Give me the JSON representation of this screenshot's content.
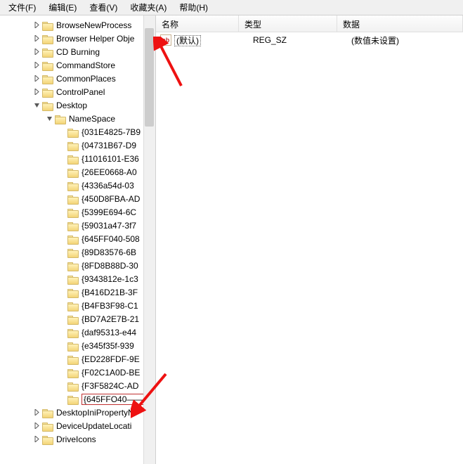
{
  "menu": {
    "file": "文件(F)",
    "edit": "编辑(E)",
    "view": "查看(V)",
    "favorites": "收藏夹(A)",
    "help": "帮助(H)"
  },
  "tree": {
    "items": [
      {
        "indent": 46,
        "expander": "right",
        "label": "BrowseNewProcess"
      },
      {
        "indent": 46,
        "expander": "right",
        "label": "Browser Helper Obje"
      },
      {
        "indent": 46,
        "expander": "right",
        "label": "CD Burning"
      },
      {
        "indent": 46,
        "expander": "right",
        "label": "CommandStore"
      },
      {
        "indent": 46,
        "expander": "right",
        "label": "CommonPlaces"
      },
      {
        "indent": 46,
        "expander": "right",
        "label": "ControlPanel"
      },
      {
        "indent": 46,
        "expander": "down",
        "label": "Desktop"
      },
      {
        "indent": 64,
        "expander": "down",
        "label": "NameSpace"
      },
      {
        "indent": 82,
        "expander": "none",
        "label": "{031E4825-7B9"
      },
      {
        "indent": 82,
        "expander": "none",
        "label": "{04731B67-D9"
      },
      {
        "indent": 82,
        "expander": "none",
        "label": "{11016101-E36"
      },
      {
        "indent": 82,
        "expander": "none",
        "label": "{26EE0668-A0"
      },
      {
        "indent": 82,
        "expander": "none",
        "label": "{4336a54d-03"
      },
      {
        "indent": 82,
        "expander": "none",
        "label": "{450D8FBA-AD"
      },
      {
        "indent": 82,
        "expander": "none",
        "label": "{5399E694-6C"
      },
      {
        "indent": 82,
        "expander": "none",
        "label": "{59031a47-3f7"
      },
      {
        "indent": 82,
        "expander": "none",
        "label": "{645FF040-508"
      },
      {
        "indent": 82,
        "expander": "none",
        "label": "{89D83576-6B"
      },
      {
        "indent": 82,
        "expander": "none",
        "label": "{8FD8B88D-30"
      },
      {
        "indent": 82,
        "expander": "none",
        "label": "{9343812e-1c3"
      },
      {
        "indent": 82,
        "expander": "none",
        "label": "{B416D21B-3F"
      },
      {
        "indent": 82,
        "expander": "none",
        "label": "{B4FB3F98-C1"
      },
      {
        "indent": 82,
        "expander": "none",
        "label": "{BD7A2E7B-21"
      },
      {
        "indent": 82,
        "expander": "none",
        "label": "{daf95313-e44"
      },
      {
        "indent": 82,
        "expander": "none",
        "label": "{e345f35f-939"
      },
      {
        "indent": 82,
        "expander": "none",
        "label": "{ED228FDF-9E"
      },
      {
        "indent": 82,
        "expander": "none",
        "label": "{F02C1A0D-BE"
      },
      {
        "indent": 82,
        "expander": "none",
        "label": "{F3F5824C-AD"
      },
      {
        "indent": 82,
        "expander": "none",
        "label": "{645FFO40——",
        "highlighted": true
      },
      {
        "indent": 46,
        "expander": "right",
        "label": "DesktopIniPropertyN"
      },
      {
        "indent": 46,
        "expander": "right",
        "label": "DeviceUpdateLocati"
      },
      {
        "indent": 46,
        "expander": "right",
        "label": "DriveIcons"
      }
    ]
  },
  "list": {
    "headers": {
      "name": "名称",
      "type": "类型",
      "data": "数据"
    },
    "rows": [
      {
        "icon": "ab",
        "name": "(默认)",
        "type": "REG_SZ",
        "data": "(数值未设置)"
      }
    ]
  }
}
